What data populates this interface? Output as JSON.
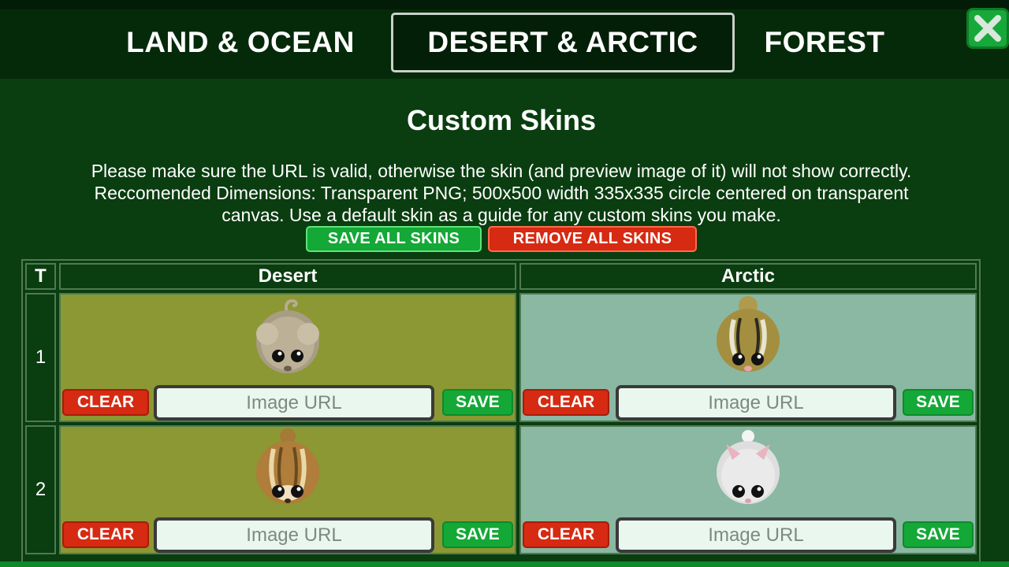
{
  "tabs": [
    {
      "label": "LAND & OCEAN",
      "active": false
    },
    {
      "label": "DESERT & ARCTIC",
      "active": true
    },
    {
      "label": "FOREST",
      "active": false
    }
  ],
  "close_icon": "close-icon",
  "heading": "Custom Skins",
  "info_lines": [
    "Please make sure the URL is valid, otherwise the skin (and preview image of it) will not show correctly.",
    "Reccomended Dimensions: Transparent PNG; 500x500 width 335x335 circle centered on transparent",
    "canvas. Use a default skin as a guide for any custom skins you make."
  ],
  "actions": {
    "save_all": "SAVE ALL SKINS",
    "remove_all": "REMOVE ALL SKINS"
  },
  "table": {
    "tier_header": "T",
    "columns": [
      "Desert",
      "Arctic"
    ],
    "rows": [
      {
        "tier": "1",
        "cells": [
          {
            "animal": "desert-mouse-icon",
            "clear": "CLEAR",
            "placeholder": "Image URL",
            "value": "",
            "save": "SAVE"
          },
          {
            "animal": "arctic-chipmunk-icon",
            "clear": "CLEAR",
            "placeholder": "Image URL",
            "value": "",
            "save": "SAVE"
          }
        ]
      },
      {
        "tier": "2",
        "cells": [
          {
            "animal": "desert-chipmunk-icon",
            "clear": "CLEAR",
            "placeholder": "Image URL",
            "value": "",
            "save": "SAVE"
          },
          {
            "animal": "arctic-hare-icon",
            "clear": "CLEAR",
            "placeholder": "Image URL",
            "value": "",
            "save": "SAVE"
          }
        ]
      }
    ]
  },
  "colors": {
    "background": "#0a3d10",
    "desert_cell": "#8c9833",
    "arctic_cell": "#8ab8a2",
    "clear_button": "#d62a12",
    "save_button": "#14a837"
  }
}
